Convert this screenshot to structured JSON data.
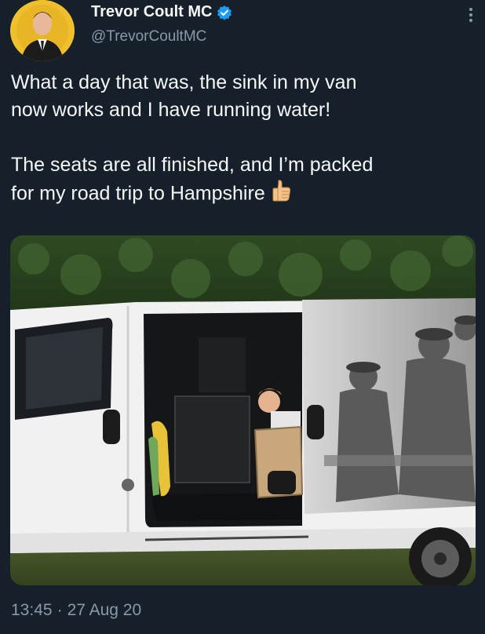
{
  "author": {
    "display_name": "Trevor Coult MC",
    "handle": "@TrevorCoultMC",
    "verified_icon": "verified-badge-icon",
    "accent_color": "#1d9bf0"
  },
  "tweet": {
    "text": "What a day that was, the sink in my van\nnow works and I have running water!\n\nThe seats are all finished, and I’m packed\nfor my road trip to Hampshire",
    "emoji_icon": "thumbs-up-icon",
    "media_icon": "photo-van-image"
  },
  "meta": {
    "time": "13:45",
    "separator": "·",
    "date": "27 Aug 20"
  },
  "colors": {
    "background": "#15202b",
    "text_primary": "#f7f9f9",
    "text_secondary": "#8b98a5"
  }
}
